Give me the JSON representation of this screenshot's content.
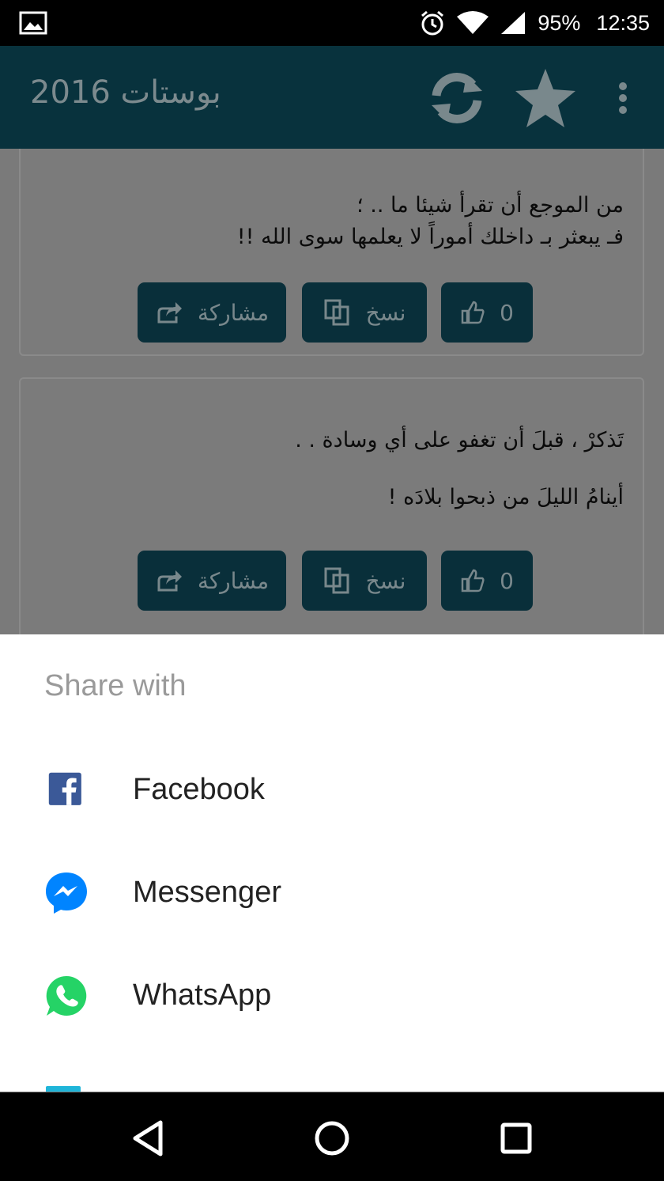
{
  "status_bar": {
    "battery": "95%",
    "time": "12:35"
  },
  "app_bar": {
    "title": "بوستات 2016"
  },
  "posts": [
    {
      "lines": [
        "من الموجع أن تقرأ شيئا ما .. ؛",
        "فـ يبعثر بـ داخلك أموراً لا يعلمها سوى الله !!"
      ],
      "like_count": "0",
      "copy_label": "نسخ",
      "share_label": "مشاركة"
    },
    {
      "lines": [
        "تَذكرْ ، قبلَ أن تغفو على أي وسادة . .",
        "أينامُ الليلَ من ذبحوا بلادَه !"
      ],
      "like_count": "0",
      "copy_label": "نسخ",
      "share_label": "مشاركة"
    }
  ],
  "share_sheet": {
    "heading": "Share with",
    "items": [
      {
        "label": "Facebook",
        "icon": "facebook-icon",
        "color": "#3b5998"
      },
      {
        "label": "Messenger",
        "icon": "messenger-icon",
        "color": "#0084ff"
      },
      {
        "label": "WhatsApp",
        "icon": "whatsapp-icon",
        "color": "#25d366"
      }
    ]
  },
  "colors": {
    "app_bar": "#08323d",
    "button": "#092f3a",
    "status_bar": "#000000"
  }
}
